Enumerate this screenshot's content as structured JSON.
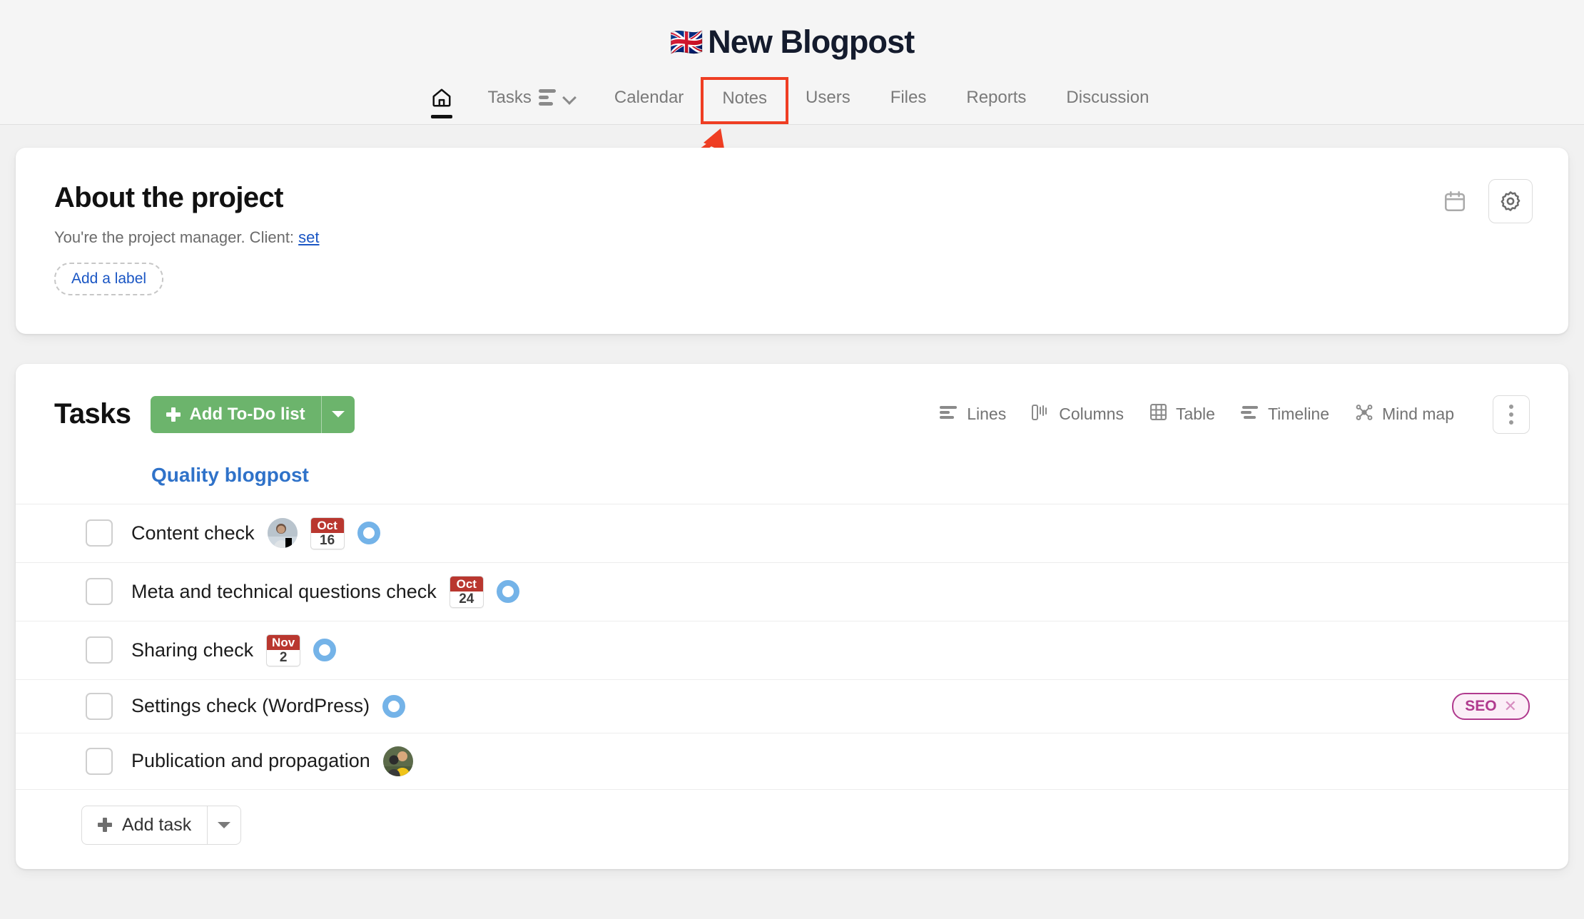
{
  "header": {
    "flag": "🇬🇧",
    "title": "New Blogpost",
    "nav": [
      {
        "id": "home",
        "label": "",
        "icon": "home-icon",
        "active": true
      },
      {
        "id": "tasks",
        "label": "Tasks",
        "icon": "list-icon",
        "has_chevron": true
      },
      {
        "id": "calendar",
        "label": "Calendar"
      },
      {
        "id": "notes",
        "label": "Notes",
        "highlighted": true
      },
      {
        "id": "users",
        "label": "Users"
      },
      {
        "id": "files",
        "label": "Files"
      },
      {
        "id": "reports",
        "label": "Reports"
      },
      {
        "id": "discussion",
        "label": "Discussion"
      }
    ],
    "annotation_color": "#ef3e23"
  },
  "about": {
    "title": "About the project",
    "subtitle_prefix": "You're the project manager. Client: ",
    "subtitle_link": "set",
    "add_label": "Add a label",
    "calendar_icon": "calendar-icon",
    "settings_icon": "gear-icon"
  },
  "tasks": {
    "title": "Tasks",
    "add_list_label": "Add To-Do list",
    "add_list_color": "#6cb46c",
    "views": [
      {
        "id": "lines",
        "label": "Lines",
        "icon": "lines-icon"
      },
      {
        "id": "columns",
        "label": "Columns",
        "icon": "columns-icon"
      },
      {
        "id": "table",
        "label": "Table",
        "icon": "table-icon"
      },
      {
        "id": "timeline",
        "label": "Timeline",
        "icon": "timeline-icon"
      },
      {
        "id": "mindmap",
        "label": "Mind map",
        "icon": "mindmap-icon"
      }
    ],
    "kebab_icon": "more-vertical-icon",
    "group_title": "Quality blogpost",
    "rows": [
      {
        "name": "Content check",
        "avatar": "person-avatar",
        "date_month": "Oct",
        "date_day": "16",
        "ring": true,
        "tag": null
      },
      {
        "name": "Meta and technical questions check",
        "avatar": null,
        "date_month": "Oct",
        "date_day": "24",
        "ring": true,
        "tag": null
      },
      {
        "name": "Sharing check",
        "avatar": null,
        "date_month": "Nov",
        "date_day": "2",
        "ring": true,
        "tag": null
      },
      {
        "name": "Settings check (WordPress)",
        "avatar": null,
        "date_month": null,
        "date_day": null,
        "ring": true,
        "tag": "SEO"
      },
      {
        "name": "Publication and propagation",
        "avatar": "person-avatar-2",
        "date_month": null,
        "date_day": null,
        "ring": false,
        "tag": null
      }
    ],
    "add_task_label": "Add task",
    "tag_color": "#b03a8e",
    "date_badge_color": "#b9372f",
    "ring_color": "#74b3e8",
    "group_title_color": "#2f72c9"
  }
}
